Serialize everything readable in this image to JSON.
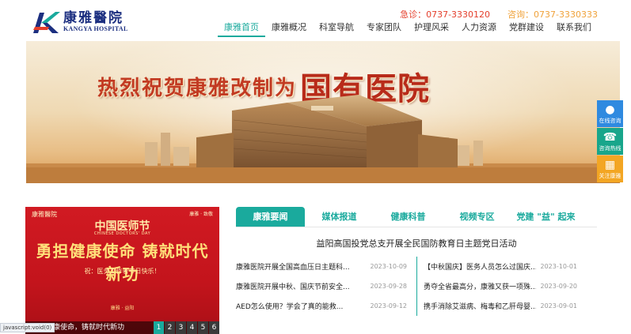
{
  "header": {
    "logo_cn": "康雅醫院",
    "logo_en": "KANGYA HOSPITAL",
    "emergency": "急诊：0737-3330120",
    "consult": "咨询：0737-3330333"
  },
  "nav": {
    "items": [
      {
        "label": "康雅首页"
      },
      {
        "label": "康雅概况"
      },
      {
        "label": "科室导航"
      },
      {
        "label": "专家团队"
      },
      {
        "label": "护理风采"
      },
      {
        "label": "人力资源"
      },
      {
        "label": "党群建设"
      },
      {
        "label": "联系我们"
      }
    ],
    "active_index": 0
  },
  "banner": {
    "text_part1": "热烈祝贺康雅改制为",
    "text_part2": "国有医院"
  },
  "side_tools": [
    {
      "label": "在线咨询",
      "icon": "chat-bubble-icon"
    },
    {
      "label": "咨询热线",
      "icon": "phone-icon"
    },
    {
      "label": "关注康雅",
      "icon": "qr-code-icon"
    }
  ],
  "slide": {
    "top_left": "康雅醫院",
    "top_right": "康雅 · 致敬",
    "heading": "中国医师节",
    "sub": "CHINESE DOCTORS' DAY",
    "slogan": "勇担健康使命 铸就时代新功",
    "greeting": "祝：医务工作者节日快乐！",
    "sign": "康雅 · 益阳",
    "caption": "健康使命，铸就时代新功",
    "pages": [
      "1",
      "2",
      "3",
      "4",
      "5",
      "6"
    ],
    "active_page": 0
  },
  "status_text": "javascript:void(0)",
  "news": {
    "tabs": [
      "康雅要闻",
      "媒体报道",
      "健康科普",
      "视频专区",
      "党建 \"益\" 起来"
    ],
    "active_tab": 0,
    "headline": "益阳高国投党总支开展全民国防教育日主题党日活动",
    "left": [
      {
        "title": "康雅医院开展全国高血压日主题科...",
        "date": "2023-10-09"
      },
      {
        "title": "康雅医院开展中秋、国庆节前安全...",
        "date": "2023-09-28"
      },
      {
        "title": "AED怎么使用？学会了真的能救...",
        "date": "2023-09-12"
      }
    ],
    "right": [
      {
        "title": "【中秋国庆】医务人员怎么过国庆...",
        "date": "2023-10-01"
      },
      {
        "title": "勇夺全省最高分，康雅又获一项殊...",
        "date": "2023-09-20"
      },
      {
        "title": "携手消除艾滋病、梅毒和乙肝母婴...",
        "date": "2023-09-01"
      }
    ]
  },
  "colors": {
    "accent": "#1aaa9d",
    "emergency": "#e43e2b",
    "consult": "#f0a23a",
    "brand": "#1c2f80"
  }
}
